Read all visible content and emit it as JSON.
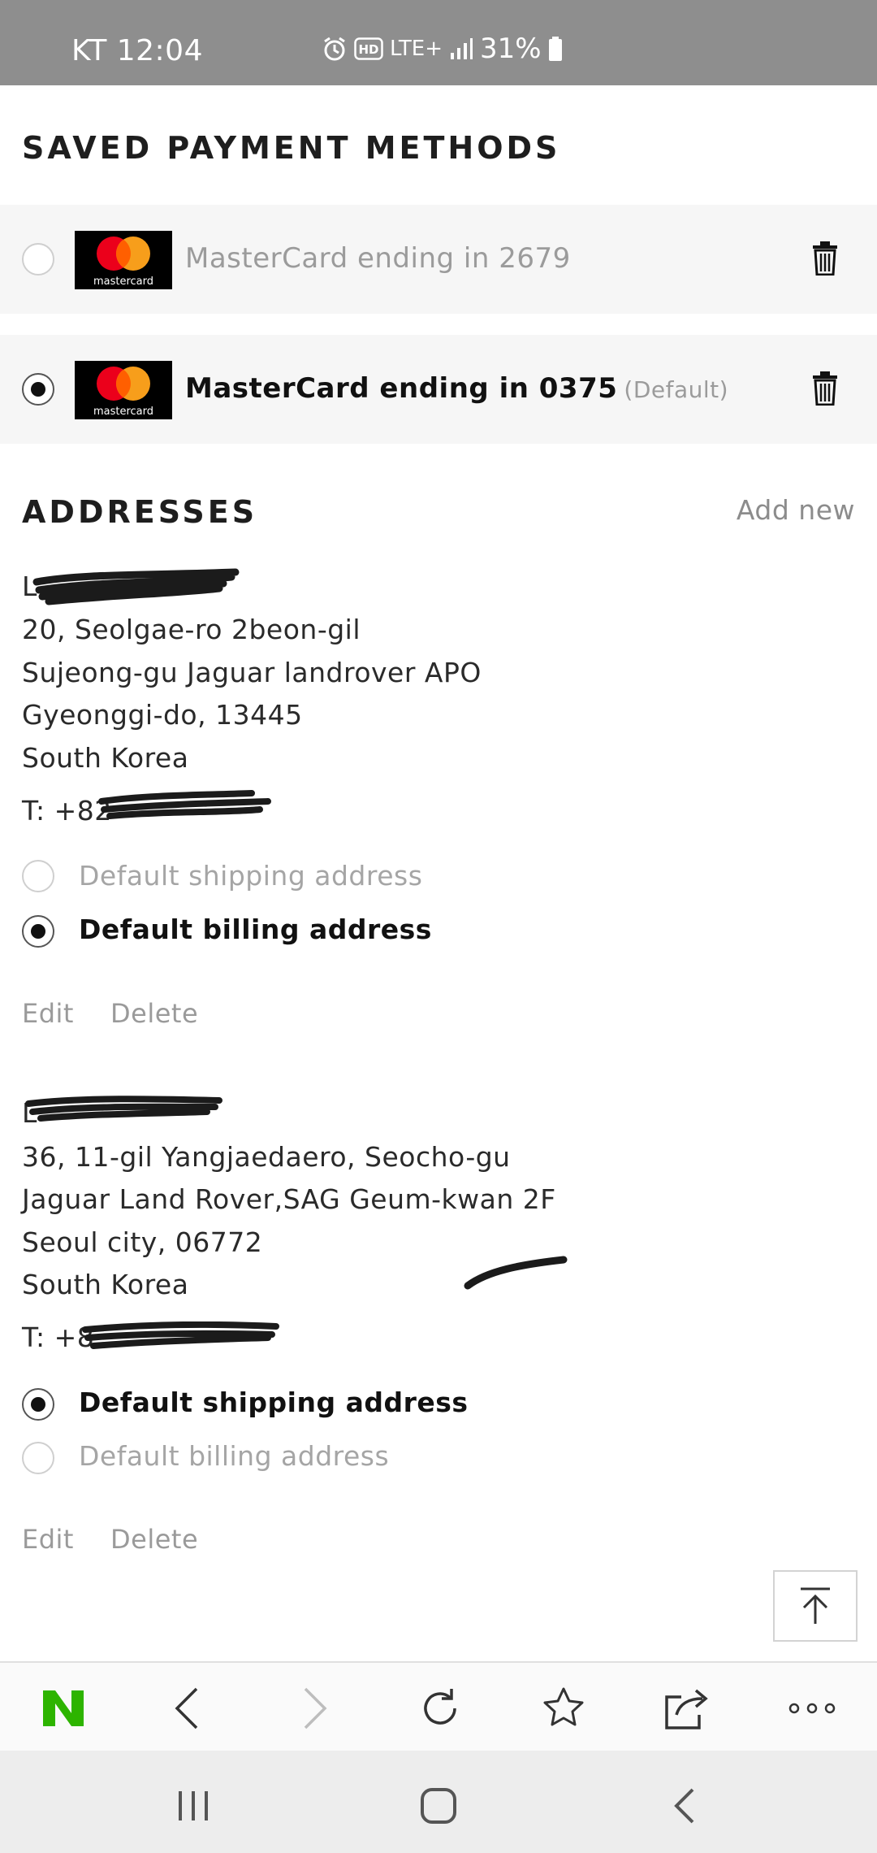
{
  "status_bar": {
    "time": "KT 12:04",
    "network": "LTE+",
    "battery": "31%",
    "icons": [
      "alarm-icon",
      "hd-icon",
      "lte-icon",
      "signal-icon",
      "battery-icon"
    ]
  },
  "payment": {
    "title": "SAVED PAYMENT METHODS",
    "cards": [
      {
        "brand": "mastercard",
        "label": "MasterCard ending in 2679",
        "default_tag": "",
        "selected": false
      },
      {
        "brand": "mastercard",
        "label": "MasterCard ending in 0375",
        "default_tag": "(Default)",
        "selected": true
      }
    ]
  },
  "addresses": {
    "title": "ADDRESSES",
    "add_new": "Add new",
    "items": [
      {
        "name": "L",
        "lines": [
          "20, Seolgae-ro 2beon-gil",
          "Sujeong-gu Jaguar landrover APO",
          "Gyeonggi-do, 13445",
          "South Korea"
        ],
        "phone": "T: +82",
        "shipping_label": "Default shipping address",
        "billing_label": "Default billing address",
        "is_default_shipping": false,
        "is_default_billing": true,
        "edit": "Edit",
        "delete": "Delete"
      },
      {
        "name": "L",
        "lines": [
          "36, 11-gil Yangjaedaero, Seocho-gu",
          "Jaguar Land Rover,SAG Geum-kwan 2F",
          "Seoul city, 06772",
          "South Korea"
        ],
        "phone": "T: +8",
        "shipping_label": "Default shipping address",
        "billing_label": "Default billing address",
        "is_default_shipping": true,
        "is_default_billing": false,
        "edit": "Edit",
        "delete": "Delete"
      }
    ]
  },
  "browser_toolbar": {
    "items": [
      "naver-logo-icon",
      "back-icon",
      "forward-icon",
      "refresh-icon",
      "bookmark-star-icon",
      "share-icon",
      "more-icon"
    ],
    "logo_color": "#2db400"
  },
  "system_nav": {
    "items": [
      "recent-apps-icon",
      "home-icon",
      "system-back-icon"
    ]
  },
  "scroll_to_top": "arrow-up-to-top-icon"
}
